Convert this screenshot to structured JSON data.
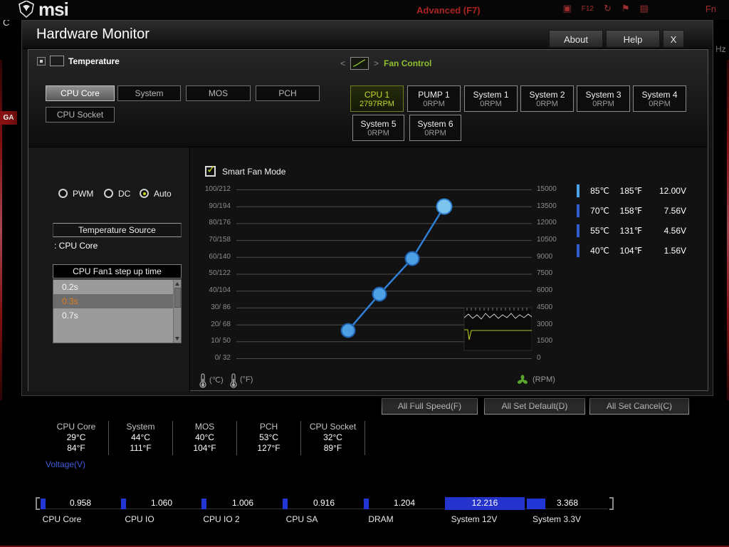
{
  "chrome": {
    "brand": "msi",
    "top_center_label": "Advanced (F7)",
    "icons": [
      {
        "name": "screenshot-icon",
        "glyph": "▣"
      },
      {
        "name": "f12-icon",
        "glyph": "F12"
      },
      {
        "name": "refresh-icon",
        "glyph": "↻"
      },
      {
        "name": "flag-icon",
        "glyph": "⚑"
      },
      {
        "name": "camera-icon",
        "glyph": "▤"
      },
      {
        "name": "fn-icon",
        "glyph": "Fn"
      }
    ],
    "left_edge_text": "C",
    "left_edge_badge": "GA",
    "right_edge_text": "Hz"
  },
  "dialog": {
    "title": "Hardware Monitor",
    "about_label": "About",
    "help_label": "Help",
    "close_label": "X"
  },
  "temperature_section": {
    "title": "Temperature",
    "buttons": [
      {
        "label": "CPU Core",
        "selected": true
      },
      {
        "label": "System",
        "selected": false
      },
      {
        "label": "MOS",
        "selected": false
      },
      {
        "label": "PCH",
        "selected": false
      },
      {
        "label": "CPU Socket",
        "selected": false
      }
    ]
  },
  "fan_section": {
    "title": "Fan Control",
    "fans": [
      {
        "name": "CPU 1",
        "rpm": "2797RPM",
        "selected": true
      },
      {
        "name": "PUMP 1",
        "rpm": "0RPM",
        "selected": false
      },
      {
        "name": "System 1",
        "rpm": "0RPM",
        "selected": false
      },
      {
        "name": "System 2",
        "rpm": "0RPM",
        "selected": false
      },
      {
        "name": "System 3",
        "rpm": "0RPM",
        "selected": false
      },
      {
        "name": "System 4",
        "rpm": "0RPM",
        "selected": false
      },
      {
        "name": "System 5",
        "rpm": "0RPM",
        "selected": false
      },
      {
        "name": "System 6",
        "rpm": "0RPM",
        "selected": false
      }
    ]
  },
  "controls": {
    "modes": [
      {
        "label": "PWM",
        "selected": false
      },
      {
        "label": "DC",
        "selected": false
      },
      {
        "label": "Auto",
        "selected": true
      }
    ],
    "temperature_source_label": "Temperature Source",
    "temperature_source_value": ": CPU Core",
    "step_time_label": "CPU Fan1 step up time",
    "step_options": [
      {
        "label": "0.2s",
        "selected": false
      },
      {
        "label": "0.3s",
        "selected": true
      },
      {
        "label": "0.7s",
        "selected": false
      }
    ]
  },
  "smart_fan": {
    "checkbox_label": "Smart Fan Mode",
    "checked": true,
    "check_glyph": "✓",
    "axis_celsius_label": "(℃)",
    "axis_fahrenheit_label": "(°F)",
    "axis_rpm_label": "(RPM)"
  },
  "chart_data": {
    "type": "line",
    "title": "Smart Fan Mode",
    "y_left_axis": "Temperature ℃/℉",
    "y_right_axis": "Fan speed RPM",
    "y_left_ticks": [
      "100/212",
      "90/194",
      "80/176",
      "70/158",
      "60/140",
      "50/122",
      "40/104",
      "30/ 86",
      "20/ 68",
      "10/ 50",
      "0/ 32"
    ],
    "y_right_ticks": [
      "15000",
      "13500",
      "12000",
      "10500",
      "9000",
      "7500",
      "6000",
      "4500",
      "3000",
      "1500",
      "0"
    ],
    "grid": true,
    "points": [
      {
        "temp_c": 40,
        "temp_f": 104,
        "voltage": "1.56V",
        "approx_rpm": 2600
      },
      {
        "temp_c": 55,
        "temp_f": 131,
        "voltage": "4.56V",
        "approx_rpm": 5800
      },
      {
        "temp_c": 70,
        "temp_f": 158,
        "voltage": "7.56V",
        "approx_rpm": 8900
      },
      {
        "temp_c": 85,
        "temp_f": 185,
        "voltage": "12.00V",
        "approx_rpm": 13400
      }
    ],
    "line_color": "#2f7fd4",
    "point_color": "#4ea0e4"
  },
  "legend": {
    "rows": [
      {
        "c": "85℃",
        "f": "185℉",
        "v": "12.00V"
      },
      {
        "c": "70℃",
        "f": "158℉",
        "v": "7.56V"
      },
      {
        "c": "55℃",
        "f": "131℉",
        "v": "4.56V"
      },
      {
        "c": "40℃",
        "f": "104℉",
        "v": "1.56V"
      }
    ]
  },
  "footer_buttons": [
    {
      "label": "All Full Speed(F)"
    },
    {
      "label": "All Set Default(D)"
    },
    {
      "label": "All Set Cancel(C)"
    }
  ],
  "temps_panel": [
    {
      "label": "CPU Core",
      "c": "29°C",
      "f": "84°F"
    },
    {
      "label": "System",
      "c": "44°C",
      "f": "111°F"
    },
    {
      "label": "MOS",
      "c": "40°C",
      "f": "104°F"
    },
    {
      "label": "PCH",
      "c": "53°C",
      "f": "127°F"
    },
    {
      "label": "CPU Socket",
      "c": "32°C",
      "f": "89°F"
    }
  ],
  "voltage_panel": {
    "title": "Voltage(V)",
    "items": [
      {
        "label": "CPU Core",
        "value": "0.958",
        "highlight": false
      },
      {
        "label": "CPU IO",
        "value": "1.060",
        "highlight": false
      },
      {
        "label": "CPU IO 2",
        "value": "1.006",
        "highlight": false
      },
      {
        "label": "CPU SA",
        "value": "0.916",
        "highlight": false
      },
      {
        "label": "DRAM",
        "value": "1.204",
        "highlight": false
      },
      {
        "label": "System 12V",
        "value": "12.216",
        "highlight": true
      },
      {
        "label": "System 3.3V",
        "value": "3.368",
        "highlight": false
      }
    ]
  },
  "colors": {
    "accent_green": "#c8d41e",
    "fan_title_green": "#8fbf2f",
    "selected_orange": "#e07c1e",
    "voltage_blue": "#2236d6",
    "legend_bar_blue": "#2e5ed0",
    "legend_bar_light": "#4da3e8",
    "advanced_red": "#b42424",
    "line_blue": "#2f7fd4"
  }
}
